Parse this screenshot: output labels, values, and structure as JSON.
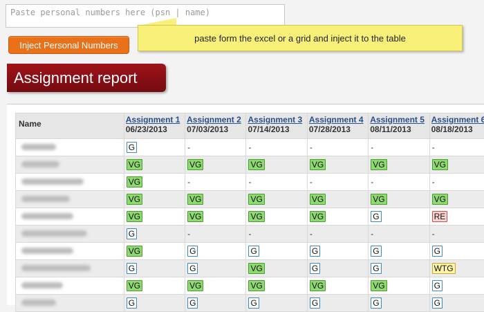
{
  "input": {
    "placeholder": "Paste personal numbers here (psn | name)"
  },
  "inject_button": {
    "label": "Inject Personal Numbers"
  },
  "tooltip": {
    "text": "paste form the excel or a grid and inject it to the table"
  },
  "report": {
    "title": "Assignment report"
  },
  "table": {
    "name_header": "Name",
    "assignments": [
      {
        "label": "Assignment 1",
        "date": "06/23/2013"
      },
      {
        "label": "Assignment 2",
        "date": "07/03/2013"
      },
      {
        "label": "Assignment 3",
        "date": "07/14/2013"
      },
      {
        "label": "Assignment 4",
        "date": "07/28/2013"
      },
      {
        "label": "Assignment 5",
        "date": "08/11/2013"
      },
      {
        "label": "Assignment 6",
        "date": "08/18/2013"
      }
    ],
    "rows": [
      {
        "blur_width": 50,
        "grades": [
          "G",
          "-",
          "-",
          "-",
          "-",
          "-"
        ]
      },
      {
        "blur_width": 55,
        "grades": [
          "VG",
          "VG",
          "VG",
          "VG",
          "VG",
          "VG"
        ]
      },
      {
        "blur_width": 90,
        "grades": [
          "VG",
          "-",
          "-",
          "-",
          "-",
          "-"
        ]
      },
      {
        "blur_width": 70,
        "grades": [
          "VG",
          "VG",
          "VG",
          "VG",
          "VG",
          "VG"
        ]
      },
      {
        "blur_width": 75,
        "grades": [
          "VG",
          "VG",
          "VG",
          "VG",
          "G",
          "RE"
        ]
      },
      {
        "blur_width": 95,
        "grades": [
          "G",
          "-",
          "-",
          "-",
          "-",
          "-"
        ]
      },
      {
        "blur_width": 75,
        "grades": [
          "VG",
          "G",
          "G",
          "G",
          "G",
          "G"
        ]
      },
      {
        "blur_width": 100,
        "grades": [
          "G",
          "G",
          "VG",
          "G",
          "G",
          "WTG"
        ]
      },
      {
        "blur_width": 60,
        "grades": [
          "VG",
          "VG",
          "VG",
          "VG",
          "VG",
          "G"
        ]
      },
      {
        "blur_width": 50,
        "grades": [
          "G",
          "G",
          "G",
          "G",
          "G",
          "G"
        ]
      }
    ]
  }
}
